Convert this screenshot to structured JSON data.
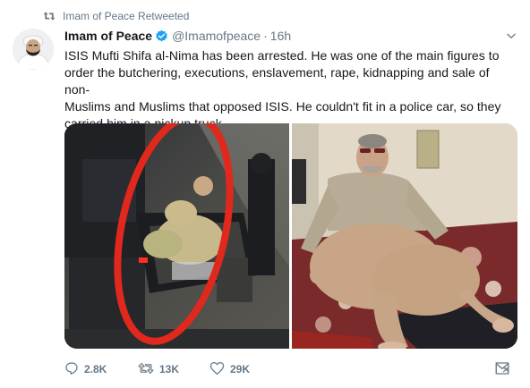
{
  "retweet_banner": {
    "icon": "retweet-icon",
    "text": "Imam of Peace Retweeted"
  },
  "author": {
    "display_name": "Imam of Peace",
    "verified": true,
    "handle": "@Imamofpeace",
    "separator": "·",
    "time": "16h"
  },
  "tweet": {
    "lines": [
      "ISIS Mufti Shifa al-Nima has been arrested. He was one of the main figures to",
      "order the butchering, executions, enslavement, rape, kidnapping and sale of non-",
      "Muslims and Muslims that opposed ISIS. He couldn't fit in a police car, so they",
      "carried him in a pickup truck."
    ]
  },
  "media": [
    {
      "alt": "photo-1"
    },
    {
      "alt": "photo-2"
    }
  ],
  "actions": {
    "reply": {
      "icon": "reply-icon",
      "count": "2.8K"
    },
    "retweet": {
      "icon": "retweet-icon",
      "count": "13K"
    },
    "like": {
      "icon": "heart-icon",
      "count": "29K"
    },
    "dm": {
      "icon": "direct-message-icon"
    }
  },
  "colors": {
    "text_primary": "#14171a",
    "text_secondary": "#657786",
    "verified_blue": "#1da1f2",
    "circle_red": "#e0281c"
  }
}
